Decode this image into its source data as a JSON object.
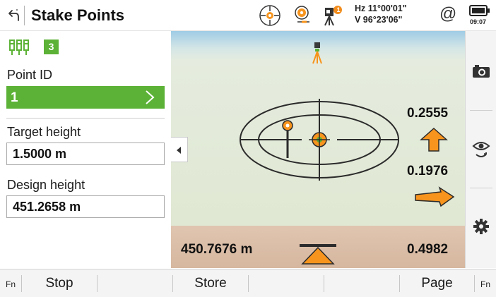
{
  "header": {
    "title": "Stake Points",
    "hz": "Hz 11°00'01\"",
    "v": "V   96°23'06\"",
    "at_symbol": "@",
    "time": "09:07",
    "notification_count": "1"
  },
  "left_panel": {
    "job_badge": "3",
    "point_id_label": "Point ID",
    "point_id_value": "1",
    "target_height_label": "Target height",
    "target_height_value": "1.5000 m",
    "design_height_label": "Design height",
    "design_height_value": "451.2658 m"
  },
  "graphic": {
    "forward_value": "0.2555",
    "side_value": "0.1976",
    "height_diff_value": "0.4982",
    "current_height_value": "450.7676 m"
  },
  "softkeys": {
    "fn_left": "Fn",
    "f1": "Stop",
    "f3": "Store",
    "f6": "Page",
    "fn_right": "Fn"
  },
  "icons": {
    "back": "back-arrow-icon",
    "target": "crosshair-target-icon",
    "prism": "prism-icon",
    "instrument": "total-station-icon",
    "battery": "battery-icon",
    "camera": "camera-icon",
    "eye": "eye-rotate-icon",
    "settings": "gear-icon",
    "job": "job-points-icon"
  },
  "colors": {
    "accent_green": "#5cb236",
    "arrow_orange": "#f7941d",
    "notification_orange": "#f28c1c"
  }
}
